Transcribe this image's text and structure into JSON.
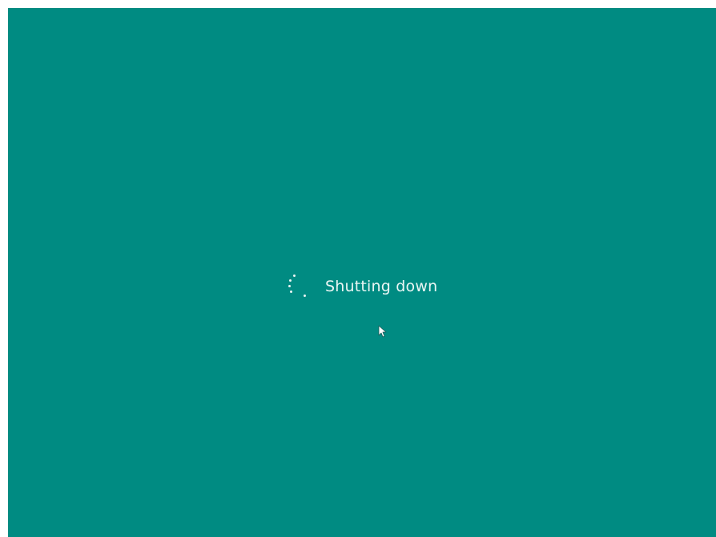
{
  "screen": {
    "background_color": "#008b82",
    "status_text": "Shutting down",
    "spinner_icon": "loading-dots-icon",
    "cursor_icon": "mouse-pointer-icon"
  }
}
